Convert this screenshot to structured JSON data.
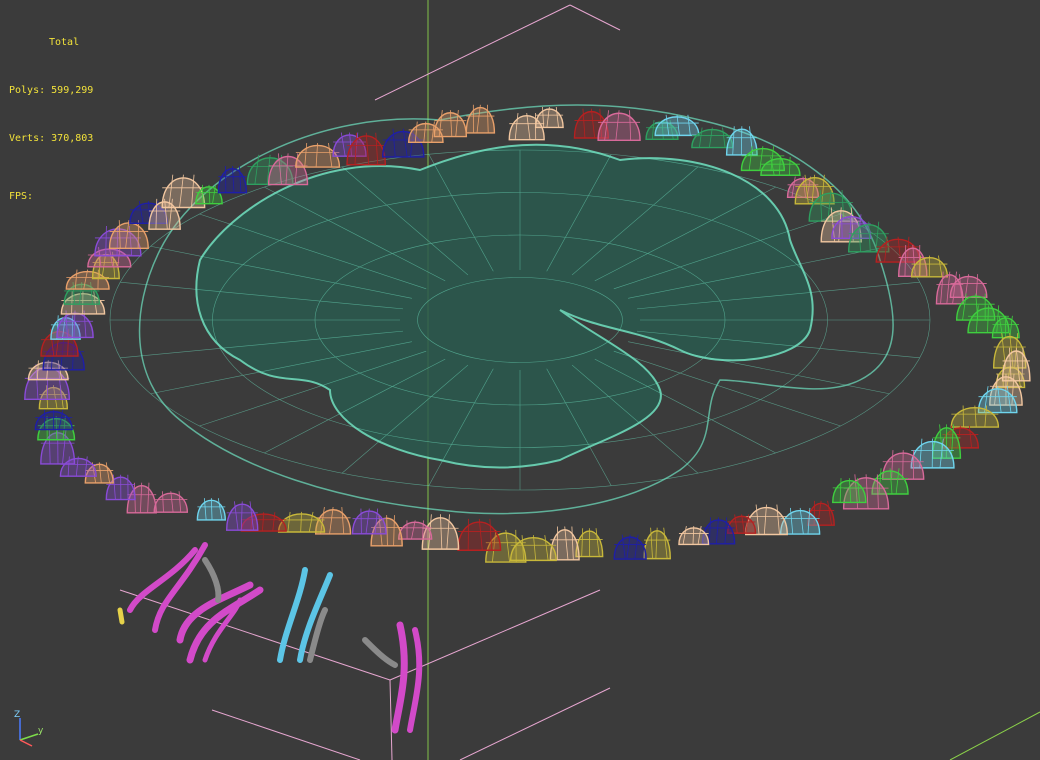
{
  "viewport": {
    "stats": {
      "header": "Total",
      "polys_label": "Polys:",
      "polys_value": "599,299",
      "verts_label": "Verts:",
      "verts_value": "370,803",
      "fps_label": "FPS:"
    },
    "axis": {
      "z_label": "Z",
      "y_label": "y"
    }
  },
  "colors": {
    "background": "#3b3b3b",
    "stats_text": "#f2e23a",
    "grid_pink": "#e6a6d0",
    "grid_green": "#8bd14a",
    "water_wire": "#6fe3c2",
    "water_fill": "#2a5a4e"
  },
  "scene": {
    "object": "pond-wireframe",
    "rock_colors": [
      "#1e1ea8",
      "#6fd5ee",
      "#3fcf3f",
      "#e8a06a",
      "#c8b83a",
      "#b62020",
      "#f2c7a0",
      "#2ea060",
      "#8a4bd8",
      "#d86a9a"
    ],
    "plant_colors": [
      "#d24ac8",
      "#5cc5e6",
      "#8a8a8a",
      "#e6d24a"
    ]
  }
}
